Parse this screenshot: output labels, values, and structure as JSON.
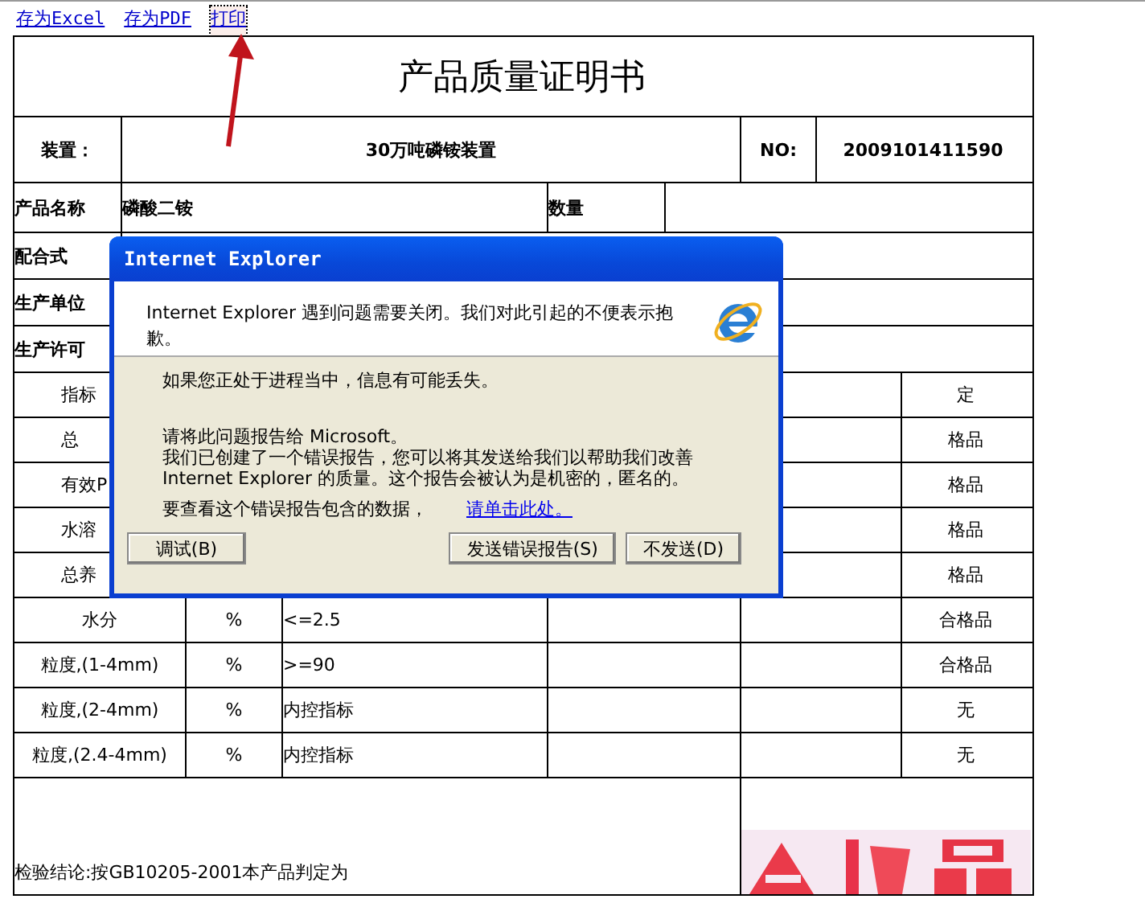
{
  "toolbar": [
    {
      "label": "存为Excel",
      "selected": false
    },
    {
      "label": "存为PDF",
      "selected": false
    },
    {
      "label": "打印",
      "selected": true
    }
  ],
  "document": {
    "title": "产品质量证明书",
    "device_label": "装置：",
    "device": "30万吨磷铵装置",
    "no_label": "NO:",
    "no": "2009101411590",
    "product_label": "产品名称",
    "product": "磷酸二铵",
    "quantity_label": "数量",
    "info_rows": [
      "配合式",
      "生产单位",
      "生产许可"
    ],
    "indicators": [
      {
        "name": "指标",
        "kind": "covered",
        "result": "定"
      },
      {
        "name": "总",
        "kind": "covered",
        "result": "格品"
      },
      {
        "name": "有效P",
        "kind": "covered",
        "result": "格品"
      },
      {
        "name": "水溶",
        "kind": "covered",
        "result": "格品"
      },
      {
        "name": "总养",
        "kind": "covered",
        "result": "格品"
      },
      {
        "name": "水分",
        "unit": "%",
        "standard": "<=2.5",
        "result": "合格品"
      },
      {
        "name": "粒度,(1-4mm)",
        "unit": "%",
        "standard": ">=90",
        "result": "合格品"
      },
      {
        "name": "粒度,(2-4mm)",
        "unit": "%",
        "standard": "内控指标",
        "result": "无"
      },
      {
        "name": "粒度,(2.4-4mm)",
        "unit": "%",
        "standard": "内控指标",
        "result": "无"
      }
    ],
    "conclusion": "检验结论:按GB10205-2001本产品判定为"
  },
  "dialog": {
    "title": "Internet Explorer",
    "message": "Internet Explorer 遇到问题需要关闭。我们对此引起的不便表示抱歉。",
    "info": "如果您正处于进程当中，信息有可能丢失。",
    "report_lines": [
      "请将此问题报告给 Microsoft。",
      "我们已创建了一个错误报告，您可以将其发送给我们以帮助我们改善 Internet Explorer 的质量。这个报告会被认为是机密的，匿名的。"
    ],
    "view_text": "要查看这个错误报告包含的数据，",
    "link": "请单击此处。",
    "buttons": [
      {
        "label": "调试(B)",
        "kind": "left"
      },
      {
        "label": "发送错误报告(S)",
        "kind": "right"
      },
      {
        "label": "不发送(D)",
        "kind": "right"
      }
    ]
  }
}
